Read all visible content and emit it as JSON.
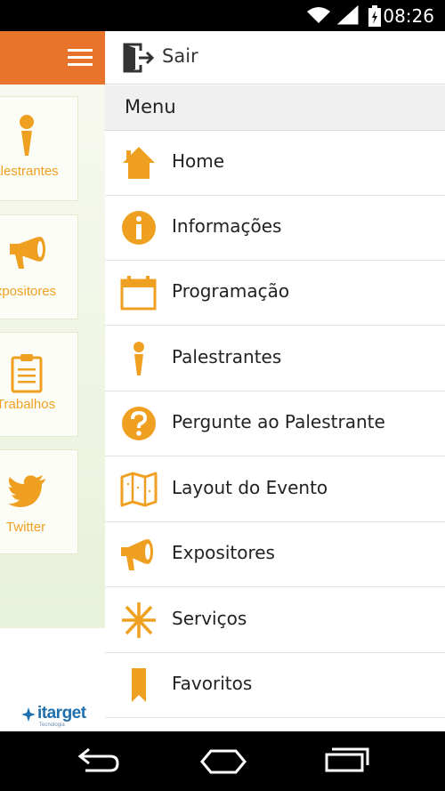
{
  "status_bar": {
    "time": "08:26"
  },
  "background_app": {
    "tiles": [
      {
        "label": "alestrantes"
      },
      {
        "label": "xpositores"
      },
      {
        "label": "Trabalhos"
      },
      {
        "label": "Twitter"
      }
    ],
    "brand": {
      "name": "itarget",
      "tagline": "Tecnologia"
    }
  },
  "drawer": {
    "logout_label": "Sair",
    "menu_header": "Menu",
    "items": [
      {
        "label": "Home",
        "icon": "home-icon"
      },
      {
        "label": "Informações",
        "icon": "info-icon"
      },
      {
        "label": "Programação",
        "icon": "calendar-icon"
      },
      {
        "label": "Palestrantes",
        "icon": "microphone-icon"
      },
      {
        "label": "Pergunte ao Palestrante",
        "icon": "question-icon"
      },
      {
        "label": "Layout do Evento",
        "icon": "map-icon"
      },
      {
        "label": "Expositores",
        "icon": "megaphone-icon"
      },
      {
        "label": "Serviços",
        "icon": "asterisk-icon"
      },
      {
        "label": "Favoritos",
        "icon": "bookmark-icon"
      }
    ]
  },
  "colors": {
    "accent": "#f0a020",
    "header_orange": "#e8742c",
    "brand_blue": "#1e6fae"
  }
}
